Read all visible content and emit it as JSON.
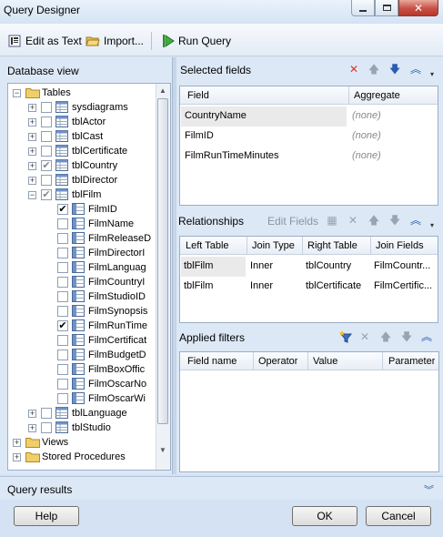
{
  "window": {
    "title": "Query Designer"
  },
  "toolbar": {
    "edit_as_text": "Edit as Text",
    "import": "Import...",
    "run_query": "Run Query"
  },
  "database_view": {
    "label": "Database view",
    "tree": [
      {
        "label": "Tables",
        "level": 0,
        "type": "folder",
        "expanded": true
      },
      {
        "label": "sysdiagrams",
        "level": 1,
        "type": "table",
        "checked": "none"
      },
      {
        "label": "tblActor",
        "level": 1,
        "type": "table",
        "checked": "none"
      },
      {
        "label": "tblCast",
        "level": 1,
        "type": "table",
        "checked": "none"
      },
      {
        "label": "tblCertificate",
        "level": 1,
        "type": "table",
        "checked": "none"
      },
      {
        "label": "tblCountry",
        "level": 1,
        "type": "table",
        "checked": "partial"
      },
      {
        "label": "tblDirector",
        "level": 1,
        "type": "table",
        "checked": "none"
      },
      {
        "label": "tblFilm",
        "level": 1,
        "type": "table",
        "checked": "partial",
        "expanded": true
      },
      {
        "label": "FilmID",
        "level": 2,
        "type": "column",
        "checked": "full"
      },
      {
        "label": "FilmName",
        "level": 2,
        "type": "column",
        "checked": "none"
      },
      {
        "label": "FilmReleaseD",
        "level": 2,
        "type": "column",
        "checked": "none"
      },
      {
        "label": "FilmDirectorI",
        "level": 2,
        "type": "column",
        "checked": "none"
      },
      {
        "label": "FilmLanguag",
        "level": 2,
        "type": "column",
        "checked": "none"
      },
      {
        "label": "FilmCountryI",
        "level": 2,
        "type": "column",
        "checked": "none"
      },
      {
        "label": "FilmStudioID",
        "level": 2,
        "type": "column",
        "checked": "none"
      },
      {
        "label": "FilmSynopsis",
        "level": 2,
        "type": "column",
        "checked": "none"
      },
      {
        "label": "FilmRunTime",
        "level": 2,
        "type": "column",
        "checked": "full"
      },
      {
        "label": "FilmCertificat",
        "level": 2,
        "type": "column",
        "checked": "none"
      },
      {
        "label": "FilmBudgetD",
        "level": 2,
        "type": "column",
        "checked": "none"
      },
      {
        "label": "FilmBoxOffic",
        "level": 2,
        "type": "column",
        "checked": "none"
      },
      {
        "label": "FilmOscarNo",
        "level": 2,
        "type": "column",
        "checked": "none"
      },
      {
        "label": "FilmOscarWi",
        "level": 2,
        "type": "column",
        "checked": "none"
      },
      {
        "label": "tblLanguage",
        "level": 1,
        "type": "table",
        "checked": "none"
      },
      {
        "label": "tblStudio",
        "level": 1,
        "type": "table",
        "checked": "none"
      },
      {
        "label": "Views",
        "level": 0,
        "type": "folder",
        "expanded": false
      },
      {
        "label": "Stored Procedures",
        "level": 0,
        "type": "folder",
        "expanded": false
      }
    ]
  },
  "selected_fields": {
    "title": "Selected fields",
    "columns": [
      "Field",
      "Aggregate"
    ],
    "rows": [
      {
        "field": "CountryName",
        "aggregate": "(none)"
      },
      {
        "field": "FilmID",
        "aggregate": "(none)"
      },
      {
        "field": "FilmRunTimeMinutes",
        "aggregate": "(none)"
      }
    ]
  },
  "relationships": {
    "title": "Relationships",
    "edit_fields": "Edit Fields",
    "columns": [
      "Left Table",
      "Join Type",
      "Right Table",
      "Join Fields"
    ],
    "rows": [
      {
        "left": "tblFilm",
        "join": "Inner",
        "right": "tblCountry",
        "fields": "FilmCountr..."
      },
      {
        "left": "tblFilm",
        "join": "Inner",
        "right": "tblCertificate",
        "fields": "FilmCertific..."
      }
    ]
  },
  "applied_filters": {
    "title": "Applied filters",
    "columns": [
      "Field name",
      "Operator",
      "Value",
      "Parameter"
    ]
  },
  "query_results": {
    "label": "Query results"
  },
  "buttons": {
    "help": "Help",
    "ok": "OK",
    "cancel": "Cancel"
  },
  "colors": {
    "delete_red": "#d9342b",
    "arrow_blue": "#2a5db0",
    "window_bg": "#d4e2f3"
  }
}
